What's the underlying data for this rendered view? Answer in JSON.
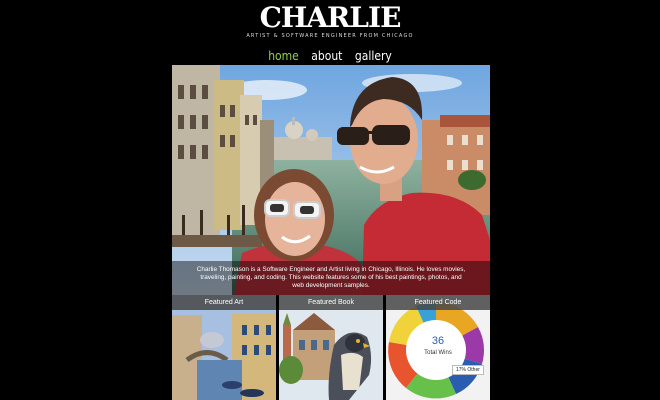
{
  "site": {
    "logo": "CHARLIE",
    "tagline": "ARTIST & SOFTWARE ENGINEER FROM CHICAGO"
  },
  "nav": {
    "items": [
      "home",
      "about",
      "gallery"
    ],
    "active": "home"
  },
  "hero": {
    "caption": "Charlie Thomason is a Software Engineer and Artist living in Chicago, Illinois. He loves movies, traveling, painting, and coding. This website features some of his best paintings, photos, and web development samples."
  },
  "features": [
    {
      "label": "Featured Art"
    },
    {
      "label": "Featured Book"
    },
    {
      "label": "Featured Code"
    }
  ],
  "code_widget": {
    "count": "36",
    "count_label": "Total Wins",
    "tooltip": "17% Other"
  },
  "colors": {
    "nav_active": "#8fd14f",
    "background": "#000000"
  }
}
